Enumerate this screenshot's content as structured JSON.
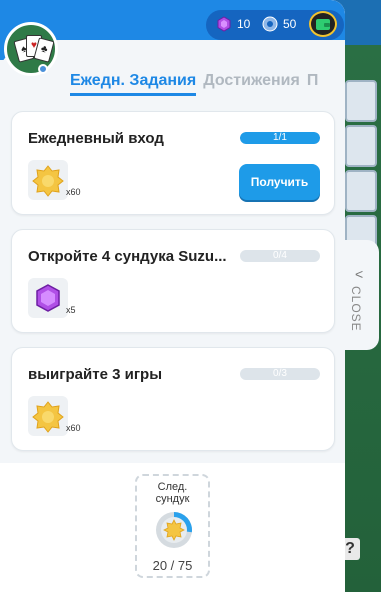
{
  "header": {
    "currency": {
      "gems": "10",
      "tokens": "50"
    }
  },
  "tabs": [
    "Ежедн. Задания",
    "Достижения",
    "П"
  ],
  "quests": [
    {
      "title": "Ежедневный вход",
      "progress": "1/1",
      "progress_fraction": 1.0,
      "reward_icon": "sun-coin-icon",
      "reward_count": "x60",
      "action": "Получить"
    },
    {
      "title": "Откройте 4 сундука Suzu...",
      "progress": "0/4",
      "progress_fraction": 0.0,
      "reward_icon": "purple-gem-icon",
      "reward_count": "x5"
    },
    {
      "title": "выиграйте 3 игры",
      "progress": "0/3",
      "progress_fraction": 0.0,
      "reward_icon": "sun-coin-icon",
      "reward_count": "x60"
    }
  ],
  "next_chest": {
    "label": "След.\nсундук",
    "count": "20 / 75",
    "fraction": 0.27
  },
  "close_tab": {
    "label": "CLOSE"
  },
  "colors": {
    "accent": "#1e88e5",
    "button": "#1e9be8",
    "coin": "#f4c542",
    "gem": "#9b3ed6"
  }
}
